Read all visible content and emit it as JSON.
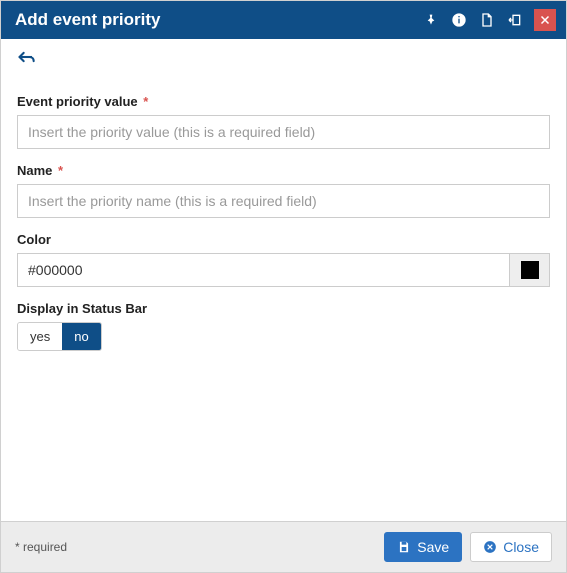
{
  "header": {
    "title": "Add event priority"
  },
  "form": {
    "priority_value": {
      "label": "Event priority value",
      "required_mark": "*",
      "placeholder": "Insert the priority value (this is a required field)",
      "value": ""
    },
    "name": {
      "label": "Name",
      "required_mark": "*",
      "placeholder": "Insert the priority name (this is a required field)",
      "value": ""
    },
    "color": {
      "label": "Color",
      "value": "#000000",
      "swatch": "#000000"
    },
    "display_status_bar": {
      "label": "Display in Status Bar",
      "options": {
        "yes": "yes",
        "no": "no"
      },
      "selected": "no"
    }
  },
  "footer": {
    "required_note": "* required",
    "save_label": "Save",
    "close_label": "Close"
  }
}
